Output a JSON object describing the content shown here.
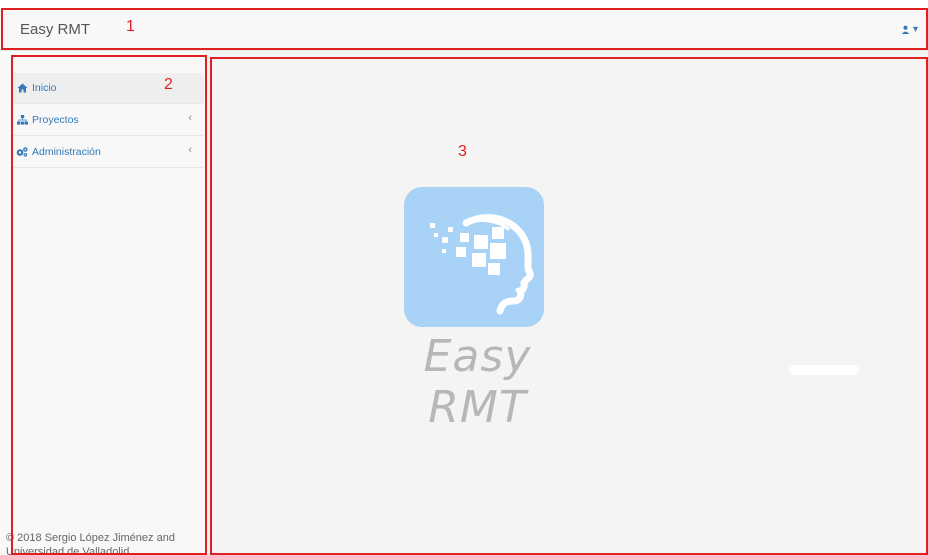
{
  "navbar": {
    "brand": "Easy RMT",
    "user_menu_icon": "user-icon",
    "user_menu_caret": "▾"
  },
  "sidebar": {
    "items": [
      {
        "label": "Inicio",
        "icon": "home-icon",
        "active": true,
        "chevron": ""
      },
      {
        "label": "Proyectos",
        "icon": "sitemap-icon",
        "active": false,
        "chevron": "‹"
      },
      {
        "label": "Administración",
        "icon": "cogs-icon",
        "active": false,
        "chevron": "‹"
      }
    ],
    "footer_line1": "© 2018 Sergio López Jiménez and",
    "footer_line2": "Universidad de Valladolid"
  },
  "main": {
    "logo_text": "Easy RMT",
    "logo_color": "#a8d3f7"
  },
  "annotations": {
    "n1": "1",
    "n2": "2",
    "n3": "3",
    "color": "#e02020"
  }
}
